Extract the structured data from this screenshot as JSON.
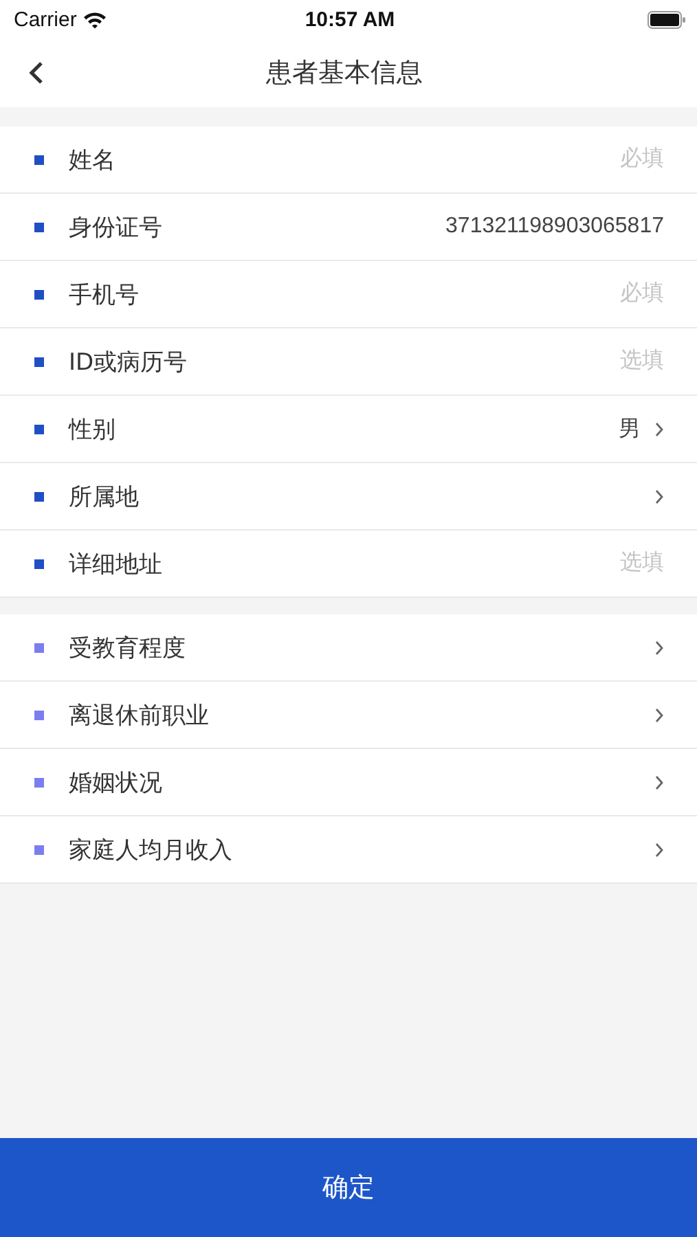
{
  "status_bar": {
    "carrier": "Carrier",
    "time": "10:57 AM"
  },
  "nav_bar": {
    "title": "患者基本信息"
  },
  "sections": [
    {
      "color": "#1f4fc4",
      "items": [
        {
          "kind": "input",
          "label": "姓名",
          "placeholder": "必填"
        },
        {
          "kind": "input",
          "label": "身份证号",
          "value": "371321198903065817"
        },
        {
          "kind": "input",
          "label": "手机号",
          "placeholder": "必填"
        },
        {
          "kind": "input",
          "label": "ID或病历号",
          "placeholder": "选填"
        },
        {
          "kind": "select",
          "label": "性别",
          "value": "男"
        },
        {
          "kind": "select",
          "label": "所属地"
        },
        {
          "kind": "input",
          "label": "详细地址",
          "placeholder": "选填"
        }
      ]
    },
    {
      "color": "#7b7ef0",
      "items": [
        {
          "kind": "select",
          "label": "受教育程度"
        },
        {
          "kind": "select",
          "label": "离退休前职业"
        },
        {
          "kind": "select",
          "label": "婚姻状况"
        },
        {
          "kind": "select",
          "label": "家庭人均月收入"
        }
      ]
    }
  ],
  "confirm_button": "确定"
}
